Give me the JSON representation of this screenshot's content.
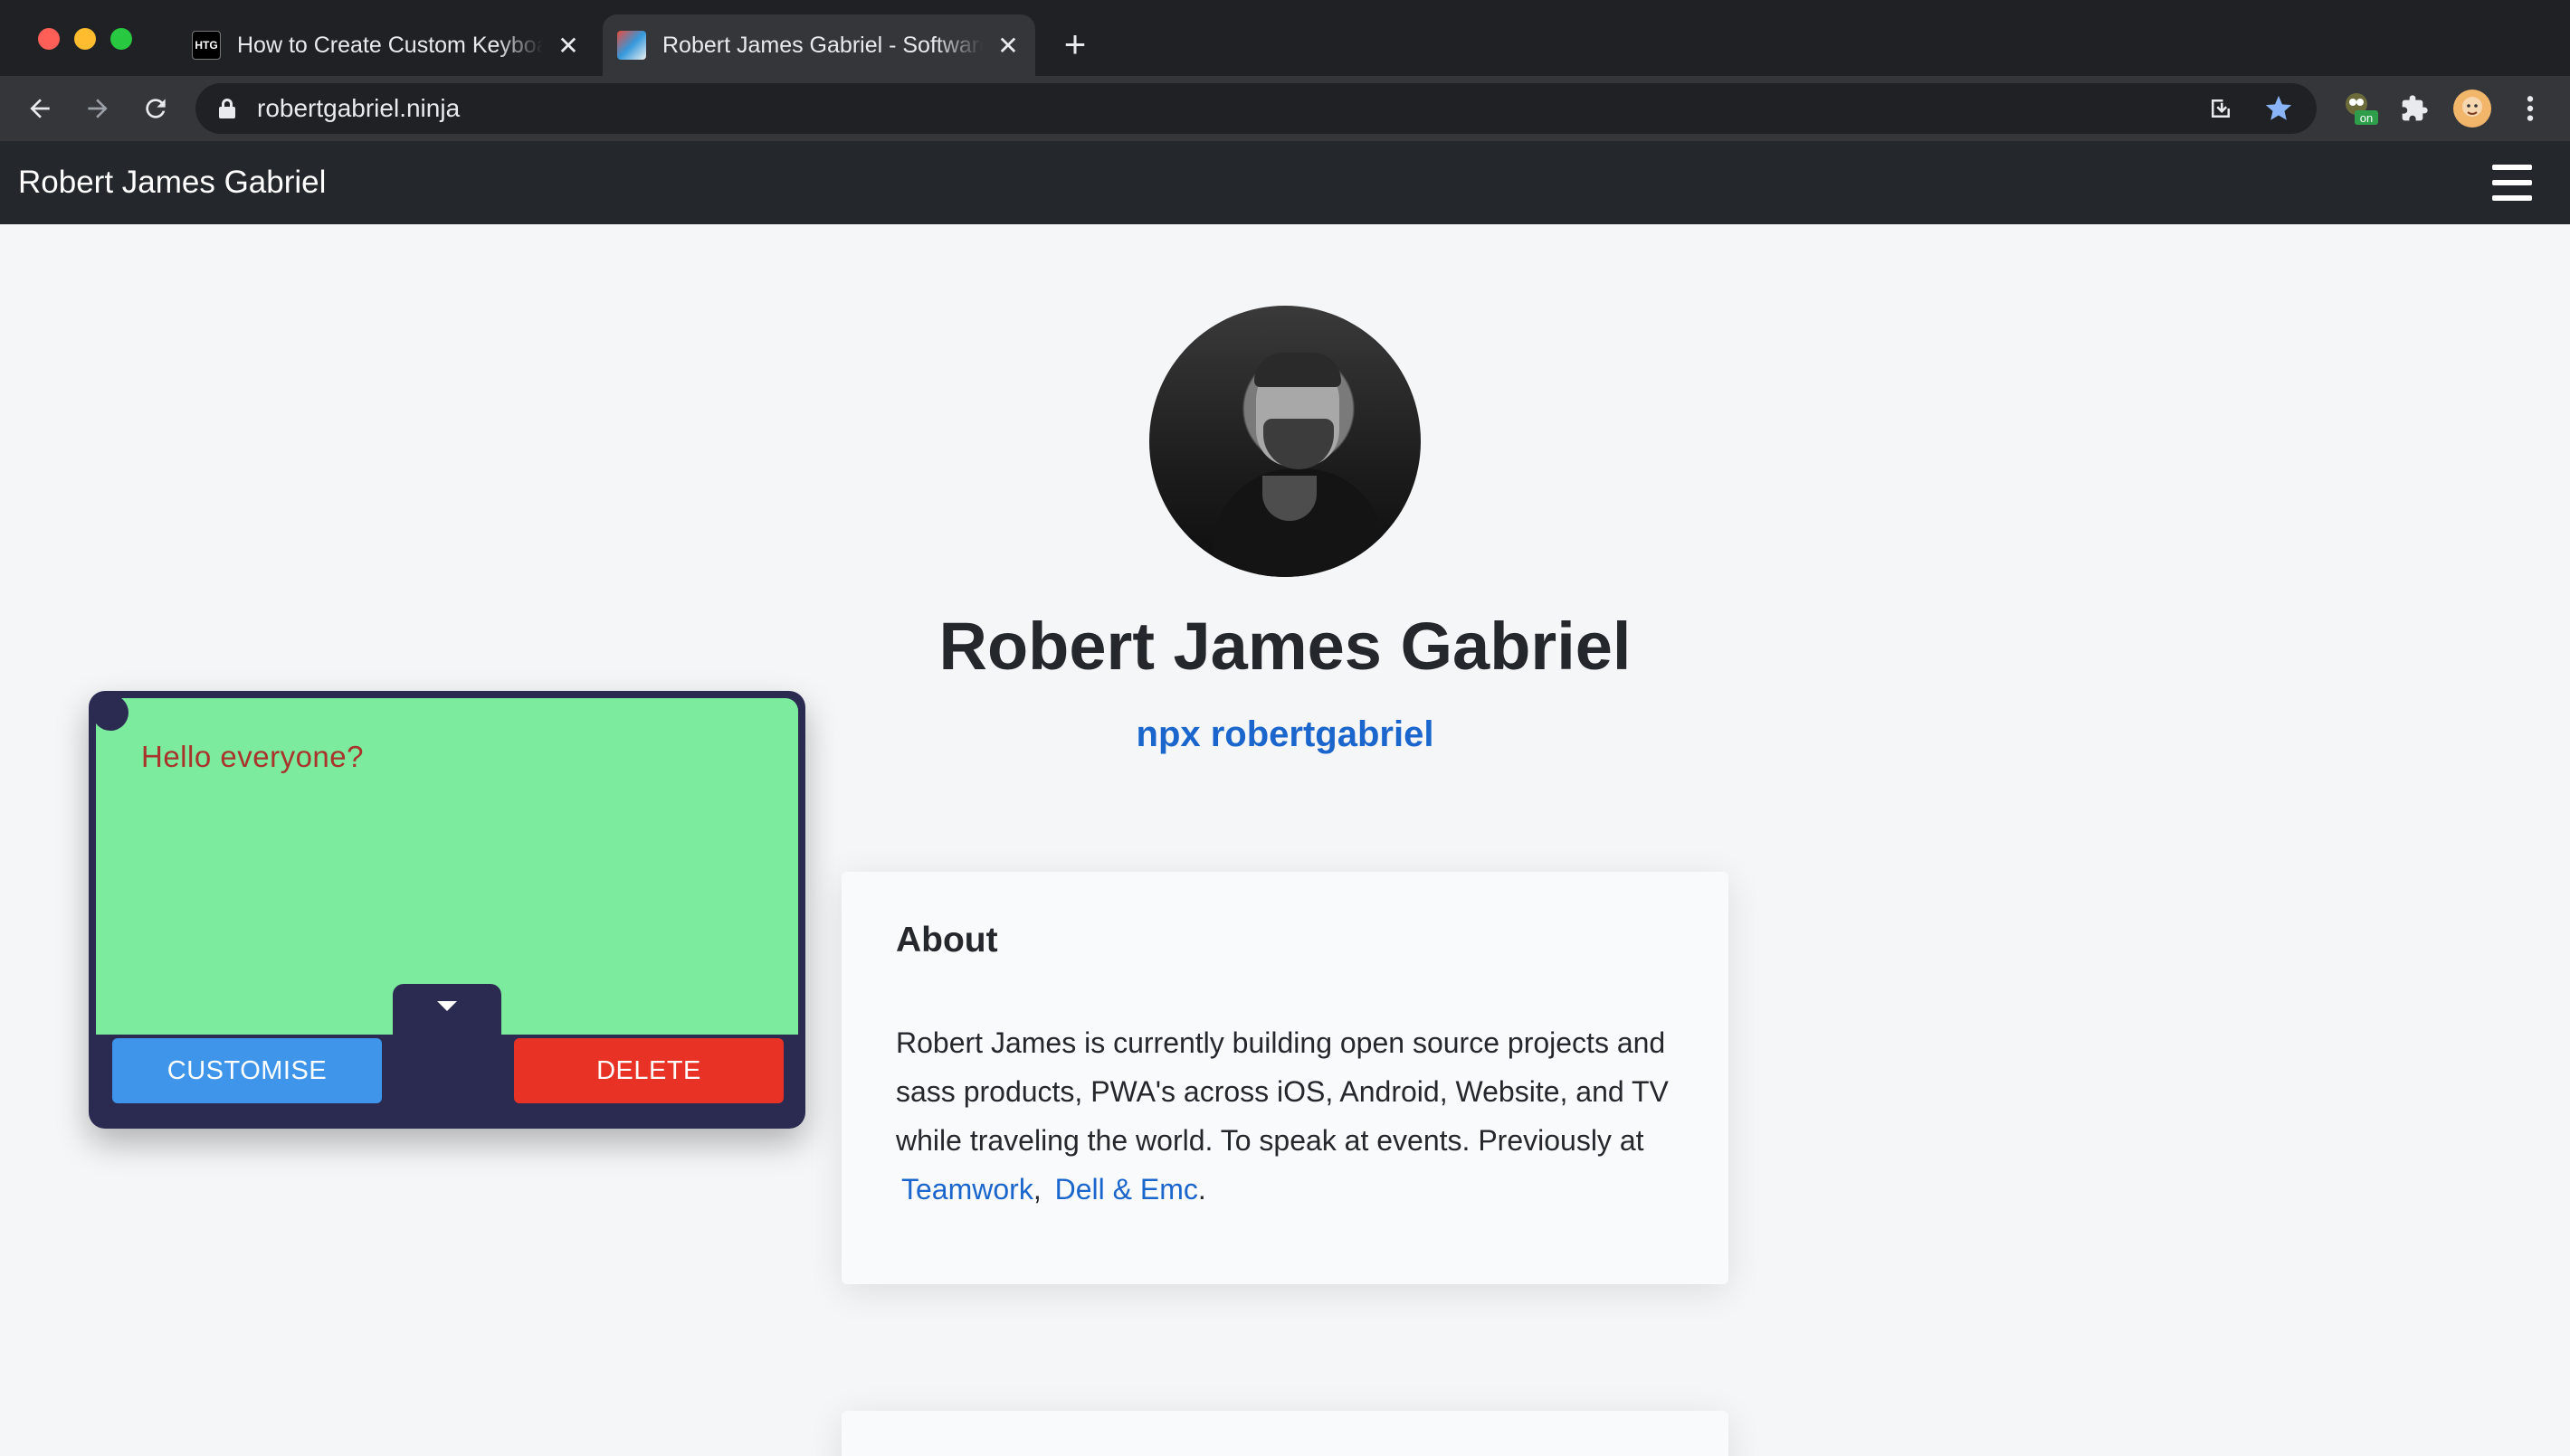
{
  "browser": {
    "tabs": [
      {
        "favicon": "HTG",
        "title": "How to Create Custom Keyboard Shortcuts",
        "active": false
      },
      {
        "favicon": "site-favicon",
        "title": "Robert James Gabriel - Software",
        "active": true
      }
    ],
    "url": "robertgabriel.ninja",
    "extension_badge": "on",
    "colors": {
      "tabbar": "#202124",
      "toolbar": "#35363a",
      "star": "#8ab4f8"
    }
  },
  "site": {
    "nav_title": "Robert James Gabriel",
    "profile_name": "Robert James Gabriel",
    "npx_command": "npx robertgabriel",
    "about": {
      "heading": "About",
      "text": "Robert James is currently building open source projects and sass products, PWA's across iOS, Android, Website, and TV while traveling the world. To speak at events. Previously at",
      "links": [
        "Teamwork",
        "Dell & Emc"
      ],
      "separator": ",",
      "end": "."
    },
    "colors": {
      "link": "#1a66cc",
      "navbar": "#24272b"
    }
  },
  "note": {
    "text": "Hello everyone?",
    "customise_label": "CUSTOMISE",
    "delete_label": "DELETE",
    "colors": {
      "background": "#7ceb9e",
      "frame": "#2b2b52",
      "text": "#a8342c",
      "customise": "#3f95ea",
      "delete": "#e83226"
    }
  }
}
